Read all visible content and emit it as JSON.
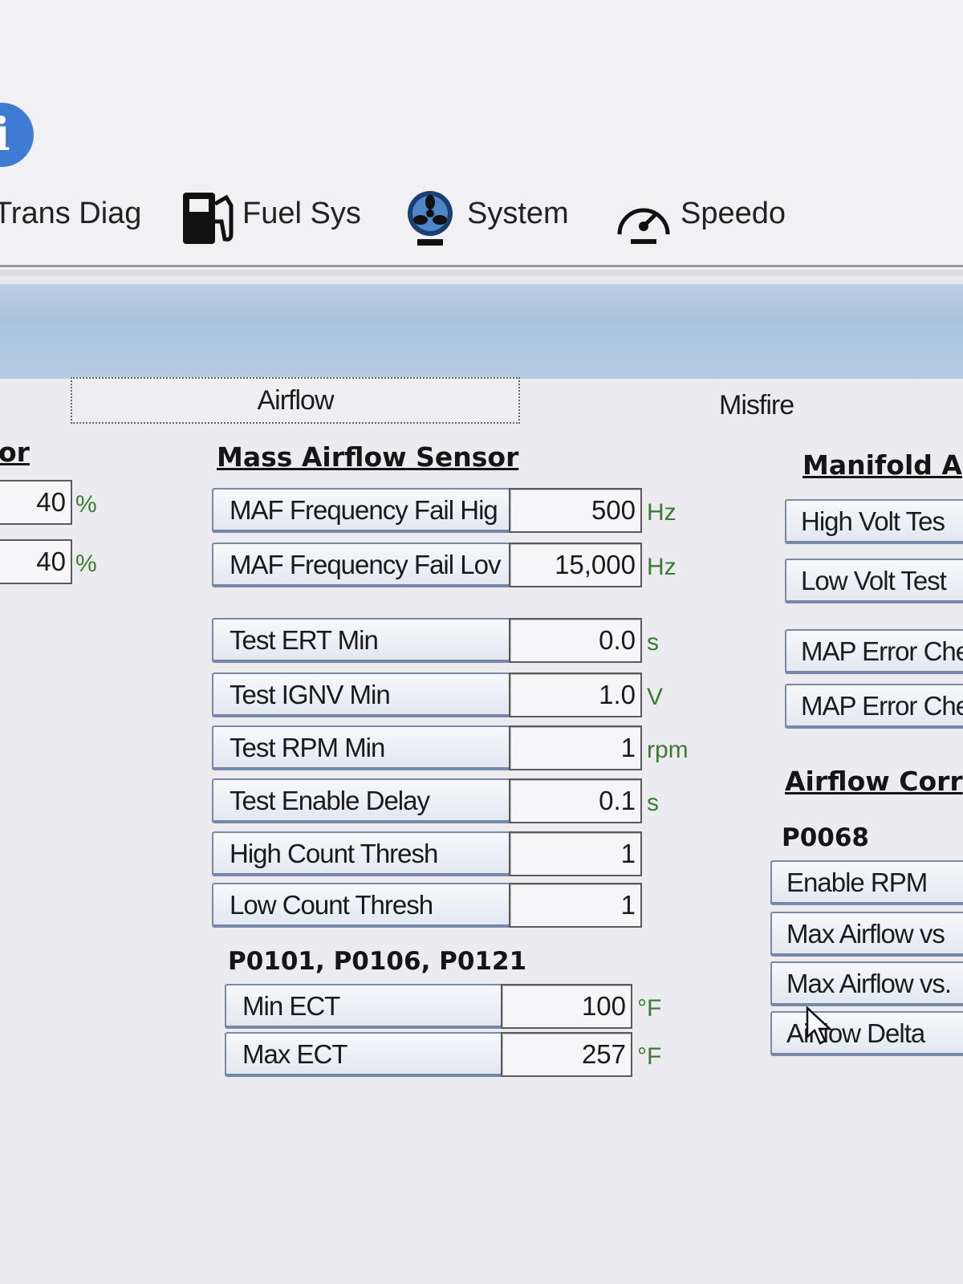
{
  "toolbar": {
    "items": [
      {
        "label": "Trans Diag",
        "icon": "trans-diag-icon"
      },
      {
        "label": "Fuel Sys",
        "icon": "fuel-pump-icon"
      },
      {
        "label": "System",
        "icon": "fan-icon"
      },
      {
        "label": "Speedo",
        "icon": "speedometer-icon"
      }
    ],
    "info_icon": "info-icon"
  },
  "tabs": {
    "airflow": "Airflow",
    "misfire": "Misfire"
  },
  "left_partial": {
    "heading": "or",
    "rows": [
      {
        "value": "40",
        "unit": "%"
      },
      {
        "value": "40",
        "unit": "%"
      }
    ]
  },
  "maf": {
    "heading": "Mass Airflow Sensor",
    "rows": [
      {
        "label": "MAF Frequency Fail Hig",
        "value": "500",
        "unit": "Hz"
      },
      {
        "label": "MAF Frequency Fail Lov",
        "value": "15,000",
        "unit": "Hz"
      },
      {
        "label": "Test ERT Min",
        "value": "0.0",
        "unit": "s"
      },
      {
        "label": "Test IGNV Min",
        "value": "1.0",
        "unit": "V"
      },
      {
        "label": "Test RPM Min",
        "value": "1",
        "unit": "rpm"
      },
      {
        "label": "Test Enable Delay",
        "value": "0.1",
        "unit": "s"
      },
      {
        "label": "High Count Thresh",
        "value": "1",
        "unit": ""
      },
      {
        "label": "Low Count Thresh",
        "value": "1",
        "unit": ""
      }
    ]
  },
  "codes": {
    "heading": "P0101, P0106, P0121",
    "rows": [
      {
        "label": "Min ECT",
        "value": "100",
        "unit": "°F"
      },
      {
        "label": "Max ECT",
        "value": "257",
        "unit": "°F"
      }
    ]
  },
  "right": {
    "heading1": "Manifold A",
    "buttons1": [
      "High Volt Tes",
      "Low Volt Test",
      "MAP Error Che",
      "MAP Error Che"
    ],
    "heading2": "Airflow Corr",
    "subhead": "P0068",
    "buttons2": [
      "Enable RPM",
      "Max Airflow vs",
      "Max Airflow vs.",
      "Airflow Delta"
    ]
  },
  "colors": {
    "band": "#afc7df",
    "unit_green": "#3d7a33",
    "info_blue": "#3f7bd3"
  }
}
